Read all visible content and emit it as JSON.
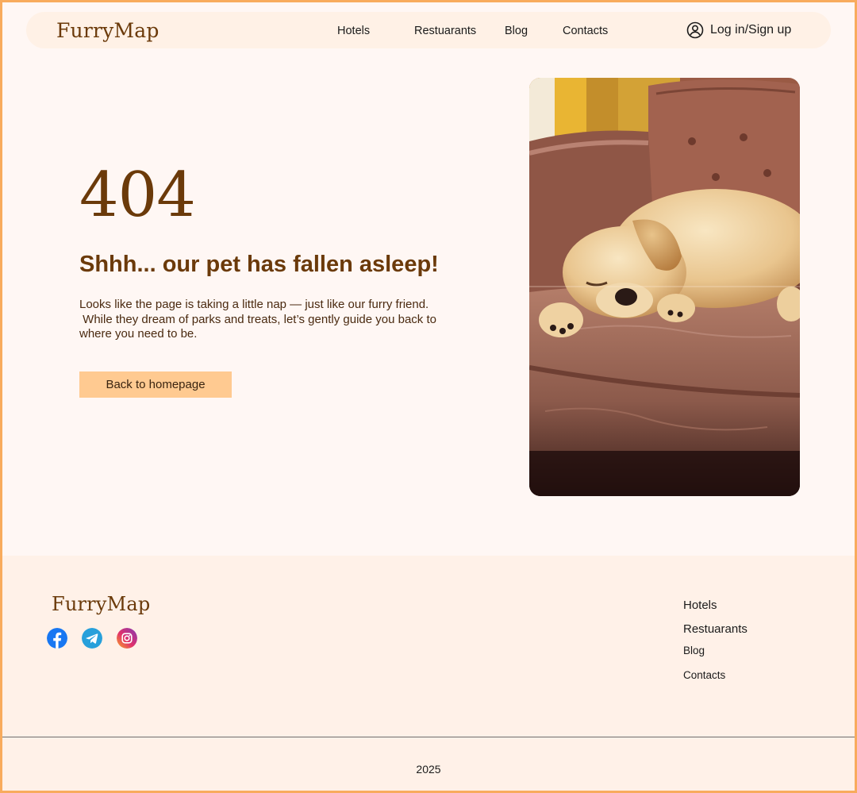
{
  "brand": {
    "name": "FurryMap"
  },
  "nav": {
    "items": [
      "Hotels",
      "Restuarants",
      "Blog",
      "Contacts"
    ],
    "login_label": "Log in/Sign up"
  },
  "error": {
    "code": "404",
    "headline": "Shhh... our pet has fallen asleep!",
    "description_lines": [
      "Looks like the page is taking a little nap — just like our furry friend.",
      " While they dream of parks and treats, let’s gently guide you back to",
      "where you need to be."
    ],
    "cta_label": "Back to homepage"
  },
  "footer": {
    "social_icons": [
      "facebook-icon",
      "telegram-icon",
      "instagram-icon"
    ],
    "links": [
      "Hotels",
      "Restuarants",
      "Blog",
      "Contacts"
    ],
    "year": "2025"
  },
  "colors": {
    "accent_brown": "#6b3a0a",
    "button_peach": "#ffca91",
    "page_bg": "#fff7f4",
    "header_bg": "#fff1e6",
    "frame_orange": "#f8ab5d"
  }
}
